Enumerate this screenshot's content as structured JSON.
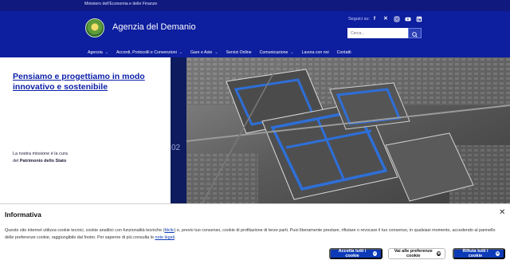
{
  "topbar": {
    "ministry": "Ministero dell'Economia e delle Finanze"
  },
  "header": {
    "site_name": "Agenzia del Demanio",
    "social_label": "Seguici su:",
    "social": [
      "facebook-icon",
      "x-icon",
      "instagram-icon",
      "youtube-icon",
      "linkedin-icon"
    ],
    "search_placeholder": "Cerca..."
  },
  "nav": [
    {
      "label": "Agenzia",
      "has_dropdown": true
    },
    {
      "label": "Accordi, Protocolli e Convenzioni",
      "has_dropdown": true
    },
    {
      "label": "Gare e Aste",
      "has_dropdown": true
    },
    {
      "label": "Servizi Online",
      "has_dropdown": false
    },
    {
      "label": "Comunicazione",
      "has_dropdown": true
    },
    {
      "label": "Lavora con noi",
      "has_dropdown": false
    },
    {
      "label": "Contatti",
      "has_dropdown": false
    }
  ],
  "hero": {
    "title": "Pensiamo e progettiamo in modo innovativo e sostenibile",
    "mission_prefix": "La nostra missione è la cura",
    "mission_line2_prefix": "del ",
    "mission_bold": "Patrimonio dello Stato",
    "slide_number": "02"
  },
  "cookie": {
    "title": "Informativa",
    "text_part1": "Questo sito internet utilizza cookie tecnici, cookie analitici con funzionalità tecniche (",
    "link1": "fdclic",
    "text_part2": ") e, previo tuo consenso, cookie di profilazione di terze parti. Puoi liberamente prestare, rifiutare o revocare il tuo consenso, in qualsiasi momento, accedendo al pannello delle preferenze cookie, raggiungibile dal footer. Per saperne di più consulta le ",
    "link2": "note legali",
    "text_part3": ".",
    "accept_label": "Accetta tutti i cookie",
    "prefs_label": "Vai alle preferenze cookie",
    "reject_label": "Rifiuta tutti i cookie"
  },
  "colors": {
    "header_bg": "#0d1e9e",
    "title_blue": "#0a1fa8",
    "button_blue": "#0d3bb8",
    "strip": "#0e1b5e"
  }
}
